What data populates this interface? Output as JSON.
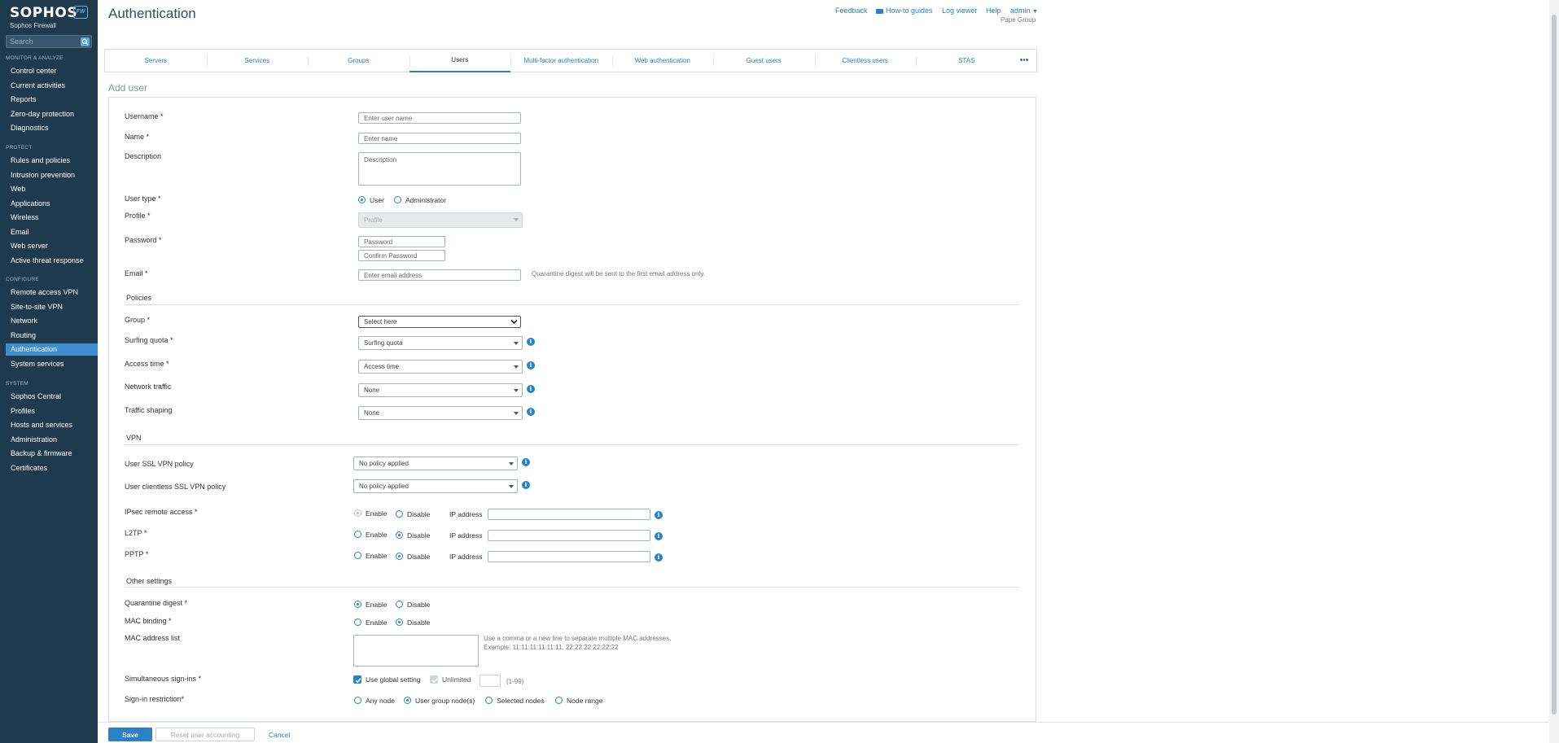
{
  "sidebar": {
    "logo_word": "SOPHOS",
    "logo_badge": "FW",
    "logo_sub": "Sophos Firewall",
    "search_placeholder": "Search",
    "sections": [
      {
        "heading": "MONITOR & ANALYZE",
        "items": [
          "Control center",
          "Current activities",
          "Reports",
          "Zero-day protection",
          "Diagnostics"
        ]
      },
      {
        "heading": "PROTECT",
        "items": [
          "Rules and policies",
          "Intrusion prevention",
          "Web",
          "Applications",
          "Wireless",
          "Email",
          "Web server",
          "Active threat response"
        ]
      },
      {
        "heading": "CONFIGURE",
        "items": [
          "Remote access VPN",
          "Site-to-site VPN",
          "Network",
          "Routing",
          "Authentication",
          "System services"
        ]
      },
      {
        "heading": "SYSTEM",
        "items": [
          "Sophos Central",
          "Profiles",
          "Hosts and services",
          "Administration",
          "Backup & firmware",
          "Certificates"
        ]
      }
    ],
    "active_item": "Authentication"
  },
  "header": {
    "title": "Authentication",
    "links": {
      "feedback": "Feedback",
      "howto": "How-to guides",
      "logviewer": "Log viewer",
      "help": "Help",
      "admin": "admin"
    },
    "company": "Pape Group"
  },
  "tabs": [
    "Servers",
    "Services",
    "Groups",
    "Users",
    "Multi-factor authentication",
    "Web authentication",
    "Guest users",
    "Clientless users",
    "STAS"
  ],
  "active_tab": "Users",
  "form": {
    "title": "Add user",
    "username": {
      "label": "Username *",
      "placeholder": "Enter user name"
    },
    "name": {
      "label": "Name *",
      "placeholder": "Enter name"
    },
    "description": {
      "label": "Description",
      "placeholder": "Description"
    },
    "user_type": {
      "label": "User type *",
      "options": [
        "User",
        "Administrator"
      ],
      "selected": "User"
    },
    "profile": {
      "label": "Profile *",
      "value": "Profile"
    },
    "password": {
      "label": "Password *",
      "placeholder": "Password",
      "confirm_placeholder": "Confirm Password"
    },
    "email": {
      "label": "Email *",
      "placeholder": "Enter email address",
      "help": "Quarantine digest will be sent to the first email address only."
    },
    "policies": {
      "heading": "Policies",
      "group": {
        "label": "Group *",
        "value": "Select here"
      },
      "surfing_quota": {
        "label": "Surfing quota *",
        "value": "Surfing quota"
      },
      "access_time": {
        "label": "Access time *",
        "value": "Access time"
      },
      "network_traffic": {
        "label": "Network traffic",
        "value": "None"
      },
      "traffic_shaping": {
        "label": "Traffic shaping",
        "value": "None"
      }
    },
    "vpn": {
      "heading": "VPN",
      "ssl_vpn": {
        "label": "User SSL VPN policy",
        "value": "No policy applied"
      },
      "clientless_ssl": {
        "label": "User clientless SSL VPN policy",
        "value": "No policy applied"
      },
      "ipsec": {
        "label": "IPsec remote access *",
        "enable": "Enable",
        "disable": "Disable",
        "ip": "IP address"
      },
      "l2tp": {
        "label": "L2TP *",
        "enable": "Enable",
        "disable": "Disable",
        "ip": "IP address"
      },
      "pptp": {
        "label": "PPTP *",
        "enable": "Enable",
        "disable": "Disable",
        "ip": "IP address"
      }
    },
    "other": {
      "heading": "Other settings",
      "quarantine": {
        "label": "Quarantine digest *",
        "enable": "Enable",
        "disable": "Disable"
      },
      "mac_binding": {
        "label": "MAC binding *",
        "enable": "Enable",
        "disable": "Disable"
      },
      "mac_list": {
        "label": "MAC address list",
        "help1": "Use a comma or a new line to separate multiple MAC addresses.",
        "help2": "Example: 11:11:11:11:11:11, 22:22:22:22:22:22"
      },
      "simultaneous": {
        "label": "Simultaneous sign-ins *",
        "global": "Use global setting",
        "unlimited": "Unlimited",
        "range": "(1-99)"
      },
      "signin_restriction": {
        "label": "Sign-in restriction*",
        "options": [
          "Any node",
          "User group node(s)",
          "Selected nodes",
          "Node range"
        ],
        "selected": "User group node(s)"
      }
    }
  },
  "footer": {
    "save": "Save",
    "reset": "Reset user accounting",
    "cancel": "Cancel"
  },
  "colors": {
    "sidebar": "#1f3a4d",
    "accent": "#2c80c4",
    "active_nav": "#3d8ed1"
  }
}
